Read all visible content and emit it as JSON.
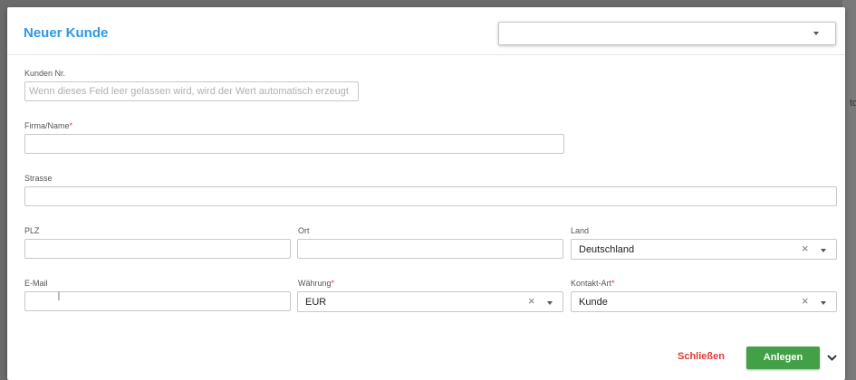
{
  "dialog": {
    "title": "Neuer Kunde",
    "top_select_value": ""
  },
  "fields": {
    "kunden_nr": {
      "label": "Kunden Nr.",
      "value": "",
      "placeholder": "Wenn dieses Feld leer gelassen wird, wird der Wert automatisch erzeugt"
    },
    "firma": {
      "label": "Firma/Name",
      "required_mark": "*",
      "value": ""
    },
    "strasse": {
      "label": "Strasse",
      "value": ""
    },
    "plz": {
      "label": "PLZ",
      "value": ""
    },
    "ort": {
      "label": "Ort",
      "value": ""
    },
    "land": {
      "label": "Land",
      "value": "Deutschland"
    },
    "email": {
      "label": "E-Mail",
      "value": ""
    },
    "waehrung": {
      "label": "Währung",
      "required_mark": "*",
      "value": "EUR"
    },
    "kontakt_art": {
      "label": "Kontakt-Art",
      "required_mark": "*",
      "value": "Kunde"
    }
  },
  "footer": {
    "close_label": "Schließen",
    "create_label": "Anlegen"
  },
  "icons": {
    "clear": "×",
    "dropdown": "caret-down-icon",
    "more": "chevron-down-icon"
  },
  "colors": {
    "title": "#2e97e8",
    "required": "#e53935",
    "close": "#e53935",
    "create_bg": "#43a047"
  },
  "background_peek": "to"
}
